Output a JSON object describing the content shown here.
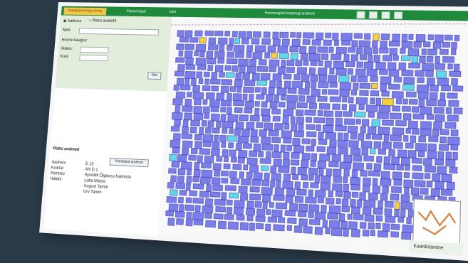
{
  "tabs": [
    {
      "label": "Detailplaneeringu otsing",
      "active": true
    },
    {
      "label": "Planeeringud",
      "active": false
    },
    {
      "label": "Infot",
      "active": false
    },
    {
      "label": "Hooneregistri kataloogi andmed",
      "active": false
    }
  ],
  "toolbar_icons": [
    "print-icon",
    "zoom-icon",
    "info-icon",
    "close-icon"
  ],
  "search": {
    "radio_aadress": "Aadress",
    "radio_platsi": "Platsi asukoht",
    "fields": [
      {
        "label": "Nimi:",
        "value": ""
      },
      {
        "label": "Hoone kaugus:",
        "value": ""
      },
      {
        "label": "Alates:",
        "value": ""
      },
      {
        "label": "Kuni:",
        "value": ""
      }
    ],
    "clear_button": "Otsi"
  },
  "details": {
    "title": "Platsi andmed",
    "button": "Kinnitatud andmed",
    "rows": [
      {
        "key": "Aadress",
        "value": "E 13"
      },
      {
        "key": "Kvartal",
        "value": "AN D 1"
      },
      {
        "key": "Kinnistu",
        "value": "Apostlik Õigeusu Kalmistu"
      },
      {
        "key": "Haldur",
        "value": "Luba Matsis"
      },
      {
        "key": "",
        "value": "August Tamm"
      },
      {
        "key": "",
        "value": "Urv Tamm"
      }
    ]
  },
  "map": {
    "fill_color": "#7b7de8",
    "stroke_color": "#3d3fb3",
    "highlight_cyan": "#5fd9e8",
    "highlight_yellow": "#f5d23a"
  },
  "footer": {
    "label": "Kaardistamine"
  }
}
